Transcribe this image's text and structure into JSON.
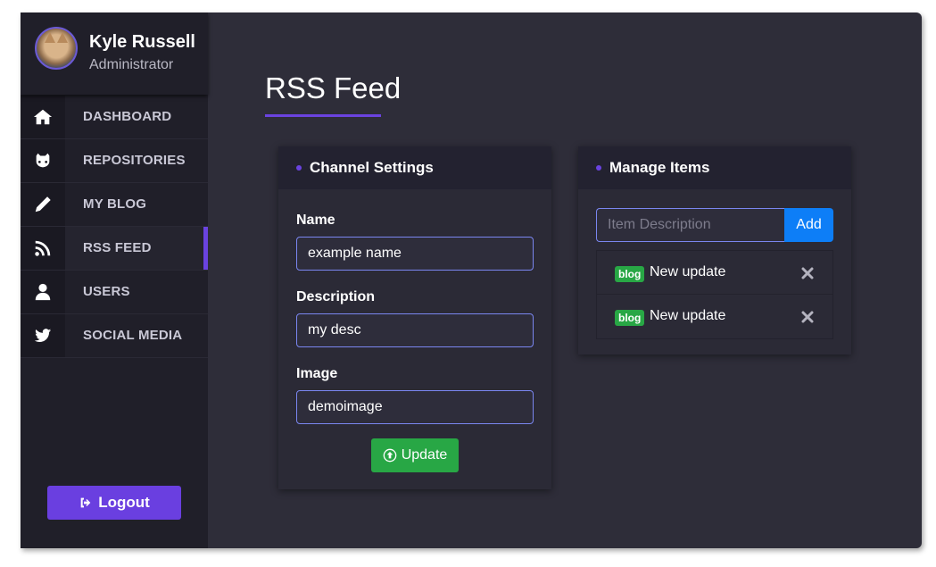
{
  "user": {
    "name": "Kyle Russell",
    "role": "Administrator"
  },
  "nav": [
    {
      "label": "DASHBOARD",
      "icon": "home-icon"
    },
    {
      "label": "REPOSITORIES",
      "icon": "github-icon"
    },
    {
      "label": "MY BLOG",
      "icon": "pencil-icon"
    },
    {
      "label": "RSS FEED",
      "icon": "rss-icon",
      "active": true
    },
    {
      "label": "USERS",
      "icon": "user-icon"
    },
    {
      "label": "SOCIAL MEDIA",
      "icon": "twitter-icon"
    }
  ],
  "logout_label": "Logout",
  "page_title": "RSS Feed",
  "channel": {
    "title": "Channel Settings",
    "name_label": "Name",
    "name_value": "example name",
    "desc_label": "Description",
    "desc_value": "my desc",
    "image_label": "Image",
    "image_value": "demoimage",
    "update_label": "Update"
  },
  "manage": {
    "title": "Manage Items",
    "input_placeholder": "Item Description",
    "add_label": "Add",
    "items": [
      {
        "badge": "blog",
        "text": "New update"
      },
      {
        "badge": "blog",
        "text": "New update"
      }
    ]
  },
  "colors": {
    "accent": "#6a43e0",
    "success": "#28a745",
    "primary": "#0d7ef7",
    "sidebar_bg": "#201f29",
    "main_bg": "#2e2d39"
  }
}
